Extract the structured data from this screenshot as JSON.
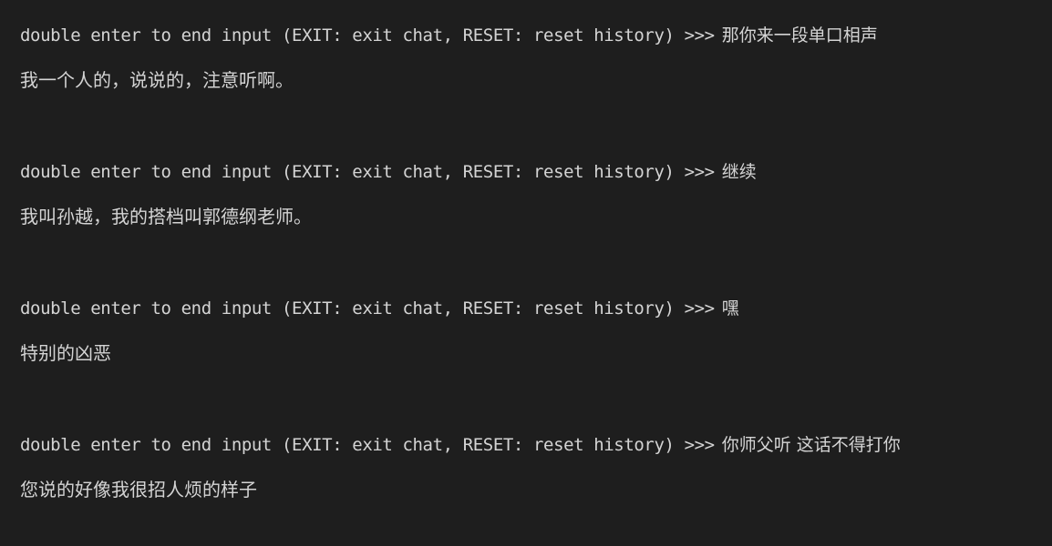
{
  "terminal": {
    "exchanges": [
      {
        "prompt": "double enter to end input (EXIT: exit chat, RESET: reset history) >>>",
        "user_input": "那你来一段单口相声",
        "response": "我一个人的，说说的，注意听啊。"
      },
      {
        "prompt": "double enter to end input (EXIT: exit chat, RESET: reset history) >>>",
        "user_input": "继续",
        "response": "我叫孙越，我的搭档叫郭德纲老师。"
      },
      {
        "prompt": "double enter to end input (EXIT: exit chat, RESET: reset history) >>>",
        "user_input": "嘿",
        "response": "特别的凶恶"
      },
      {
        "prompt": "double enter to end input (EXIT: exit chat, RESET: reset history) >>>",
        "user_input": "你师父听 这话不得打你",
        "response": "您说的好像我很招人烦的样子"
      }
    ]
  }
}
